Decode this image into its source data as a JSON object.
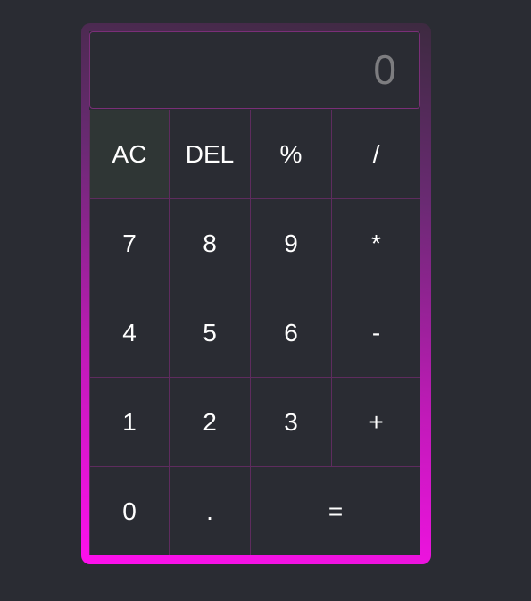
{
  "display": {
    "value": "0"
  },
  "keys": {
    "ac": "AC",
    "del": "DEL",
    "percent": "%",
    "divide": "/",
    "seven": "7",
    "eight": "8",
    "nine": "9",
    "multiply": "*",
    "four": "4",
    "five": "5",
    "six": "6",
    "minus": "-",
    "one": "1",
    "two": "2",
    "three": "3",
    "plus": "+",
    "zero": "0",
    "dot": ".",
    "equals": "="
  },
  "colors": {
    "background": "#2a2c33",
    "frame_gradient_start": "#ff10ee",
    "frame_gradient_end": "#3d2a40",
    "grid_line": "#5e2c5e",
    "display_text": "#7d7d80",
    "key_text": "#ffffff",
    "highlighted_key": "#2f3635"
  }
}
